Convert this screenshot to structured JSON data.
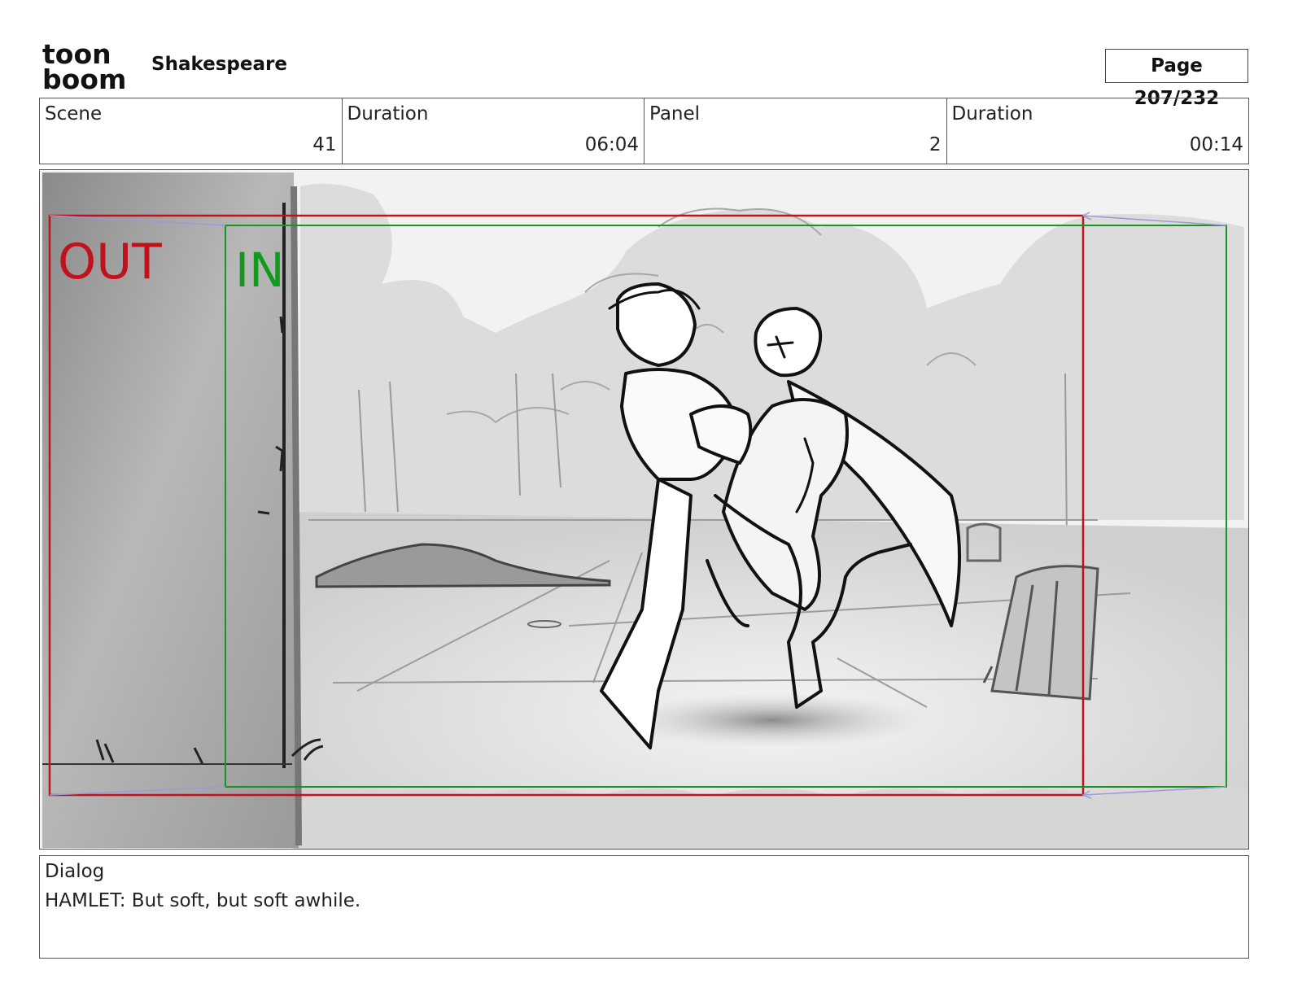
{
  "header": {
    "logo_text_top": "toon",
    "logo_text_bottom": "boom",
    "project_title": "Shakespeare",
    "page_indicator": "Page 207/232"
  },
  "info": {
    "scene_label": "Scene",
    "scene_value": "41",
    "scene_duration_label": "Duration",
    "scene_duration_value": "06:04",
    "panel_label": "Panel",
    "panel_value": "2",
    "panel_duration_label": "Duration",
    "panel_duration_value": "00:14"
  },
  "panel": {
    "out_label": "OUT",
    "in_label": "IN",
    "out_color": "#c0121c",
    "in_color": "#139a1e",
    "camera_path_color": "#9a9ad8"
  },
  "dialog": {
    "label": "Dialog",
    "text": "HAMLET: But soft, but soft awhile."
  }
}
